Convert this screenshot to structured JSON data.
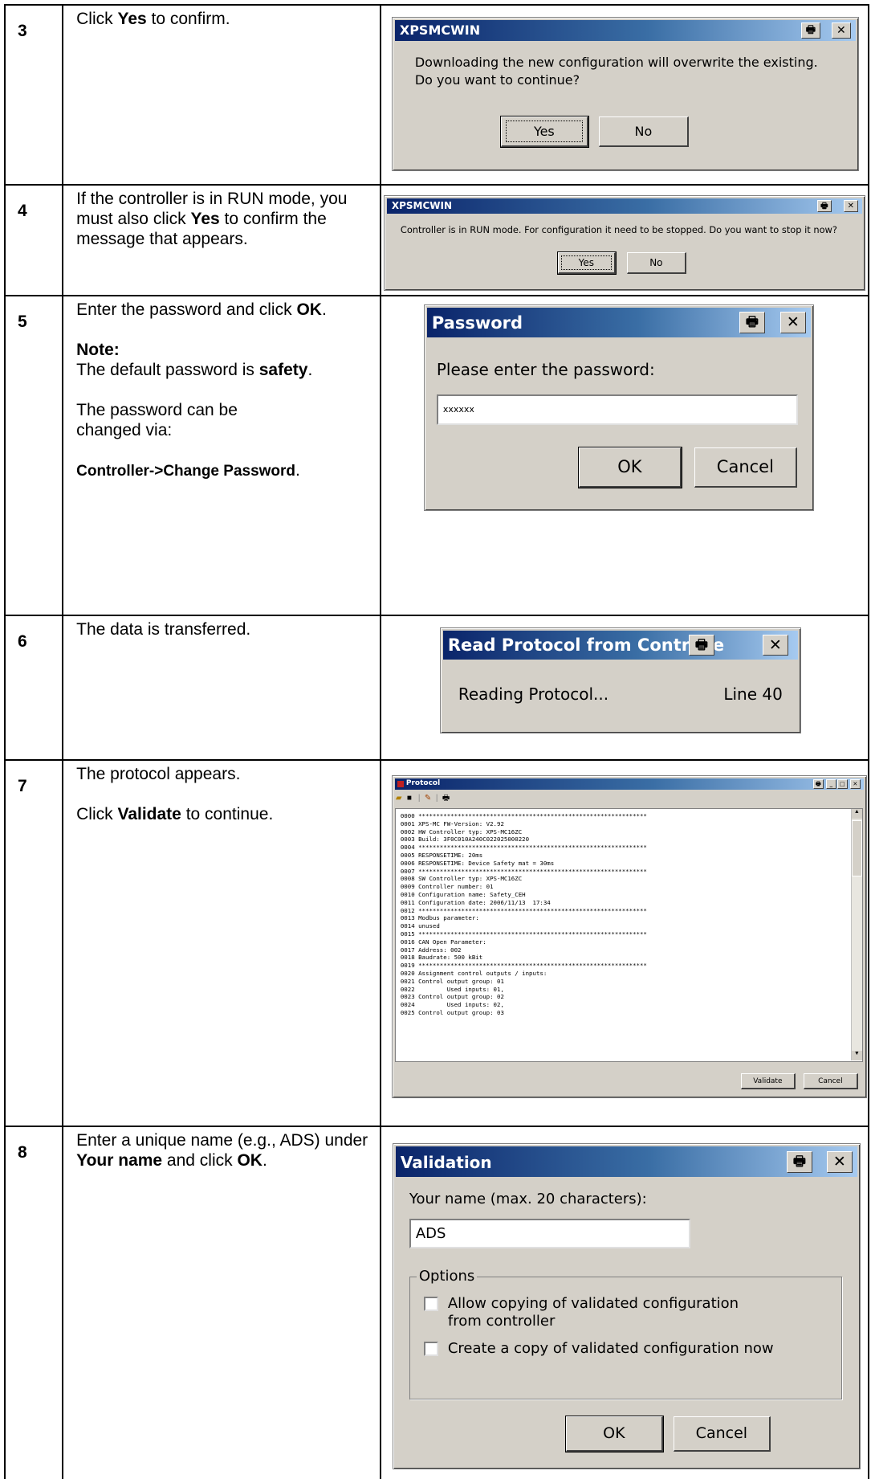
{
  "rows": [
    {
      "num": "3",
      "desc": [
        {
          "pre": "Click ",
          "bold": "Yes",
          "post": " to confirm."
        }
      ],
      "dialog": {
        "title": "XPSMCWIN",
        "message_line1": "Downloading the new configuration will overwrite the existing.",
        "message_line2": "Do you want to continue?",
        "yes": "Yes",
        "no": "No"
      }
    },
    {
      "num": "4",
      "desc_text": "If the controller is in RUN mode, you must also click ",
      "desc_bold": "Yes",
      "desc_post": " to confirm the message that appears.",
      "dialog": {
        "title": "XPSMCWIN",
        "message": "Controller is in RUN mode. For configuration it need to be stopped. Do you want to stop it now?",
        "yes": "Yes",
        "no": "No"
      }
    },
    {
      "num": "5",
      "line1_pre": "Enter the password and click ",
      "line1_bold": "OK",
      "line1_post": ".",
      "note_label": "Note:",
      "note_text": "The default password is ",
      "note_bold": "safety",
      "note_post": ".",
      "change_text": "The password can be changed via:",
      "change_path": "Controller->Change Password",
      "change_post": ".",
      "dialog": {
        "title": "Password",
        "prompt": "Please enter the password:",
        "value": "xxxxxx",
        "ok": "OK",
        "cancel": "Cancel"
      }
    },
    {
      "num": "6",
      "desc": "The data is transferred.",
      "dialog": {
        "title": "Read Protocol from Controlle",
        "status": "Reading Protocol...",
        "line": "Line 40"
      }
    },
    {
      "num": "7",
      "desc1": "The protocol appears.",
      "desc2_pre": "Click ",
      "desc2_bold": "Validate",
      "desc2_post": " to continue.",
      "window": {
        "title": "Protocol",
        "log": "0000 ****************************************************************\n0001 XPS-MC FW-Version: V2.92\n0002 HW Controller typ: XPS-MC16ZC\n0003 Build: 3F0C010A240C022025000220\n0004 ****************************************************************\n0005 RESPONSETIME: 20ms\n0006 RESPONSETIME: Device Safety mat = 30ms\n0007 ****************************************************************\n0008 SW Controller typ: XPS-MC16ZC\n0009 Controller number: 01\n0010 Configuration name: Safety_CEH\n0011 Configuration date: 2006/11/13  17:34\n0012 ****************************************************************\n0013 Modbus parameter:\n0014 unused\n0015 ****************************************************************\n0016 CAN Open Parameter:\n0017 Address: 002\n0018 Baudrate: 500 kBit\n0019 ****************************************************************\n0020 Assignment control outputs / inputs:\n0021 Control output group: 01\n0022         Used inputs: 01,\n0023 Control output group: 02\n0024         Used inputs: 02,\n0025 Control output group: 03",
        "validate": "Validate",
        "cancel": "Cancel"
      }
    },
    {
      "num": "8",
      "desc_pre": "Enter a unique name (e.g., ADS) under ",
      "desc_bold1": "Your name",
      "desc_mid": " and click ",
      "desc_bold2": "OK",
      "desc_post": ".",
      "dialog": {
        "title": "Validation",
        "label": "Your name (max. 20 characters):",
        "value": "ADS",
        "options_label": "Options",
        "opt1": "Allow copying of validated configuration from controller",
        "opt2": "Create a copy of validated configuration now",
        "ok": "OK",
        "cancel": "Cancel"
      }
    }
  ]
}
